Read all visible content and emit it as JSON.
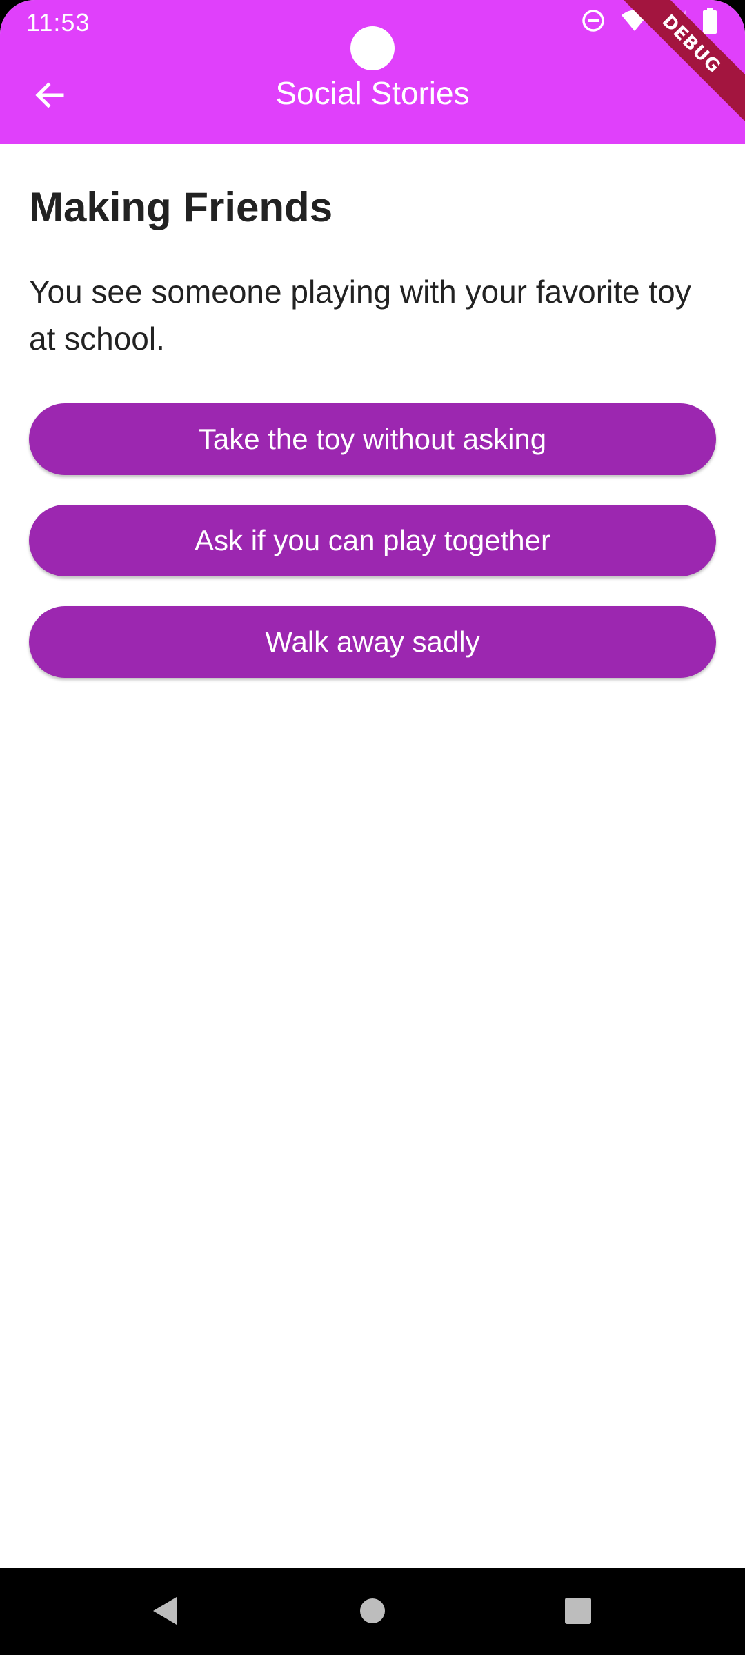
{
  "status_bar": {
    "time": "11:53",
    "icons": [
      "do-not-disturb-icon",
      "wifi-icon",
      "signal-icon",
      "battery-icon"
    ]
  },
  "app_bar": {
    "title": "Social Stories",
    "back_icon": "arrow-back-icon",
    "background_color": "#e040fb",
    "debug_label": "DEBUG"
  },
  "story": {
    "title": "Making Friends",
    "text": "You see someone playing with your favorite toy at school.",
    "choices": [
      {
        "label": "Take the toy without asking"
      },
      {
        "label": "Ask if you can play together"
      },
      {
        "label": "Walk away sadly"
      }
    ],
    "button_color": "#9c27b0"
  },
  "nav_bar": {
    "buttons": [
      "back-triangle-icon",
      "home-circle-icon",
      "recents-square-icon"
    ]
  }
}
